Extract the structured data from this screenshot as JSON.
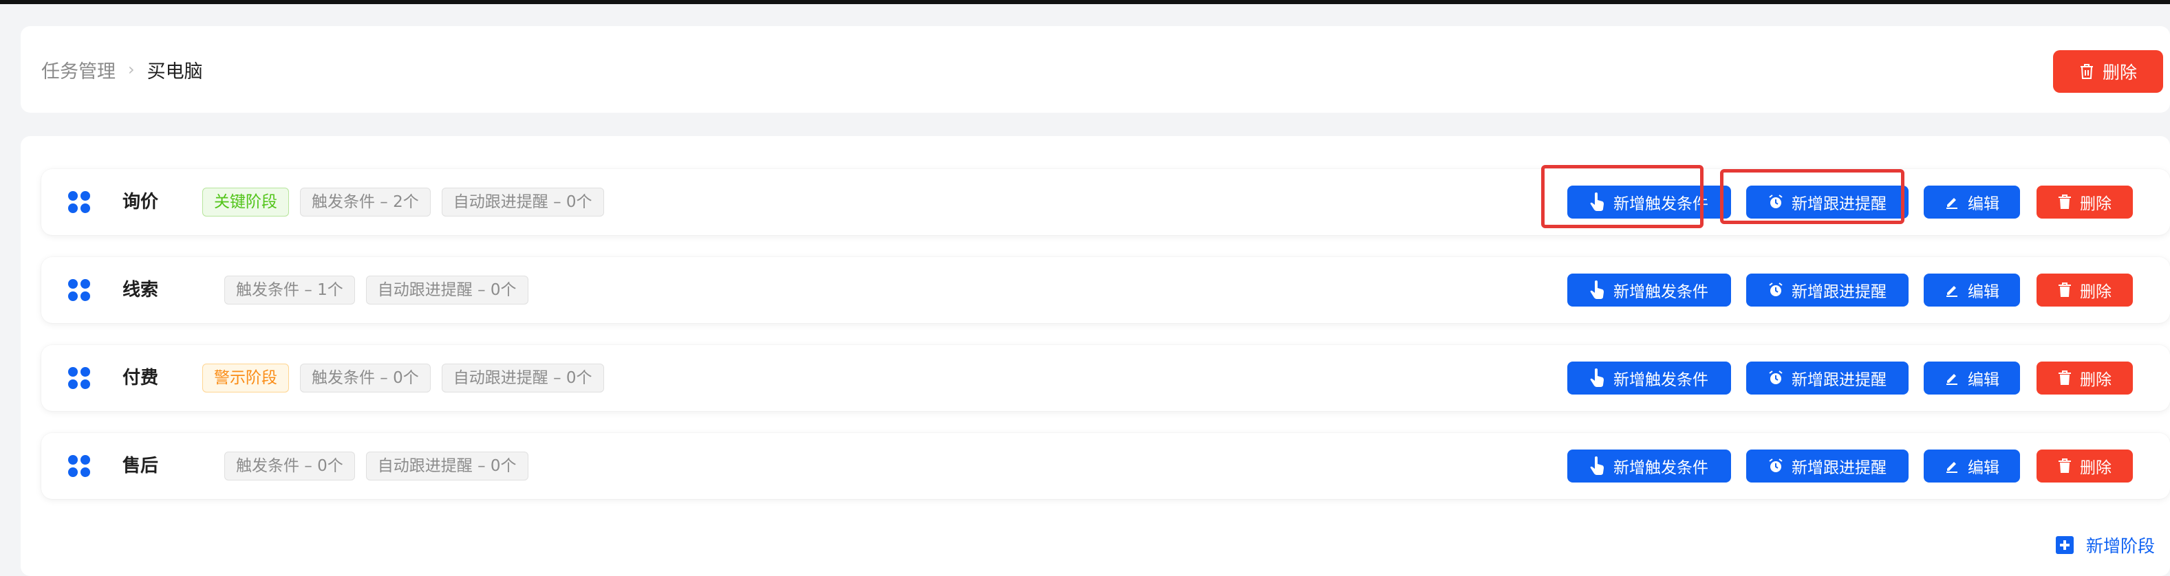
{
  "breadcrumb": {
    "root": "任务管理",
    "separator": "›",
    "current": "买电脑"
  },
  "header": {
    "delete_label": "删除"
  },
  "actions": {
    "add_trigger": "新增触发条件",
    "add_reminder": "新增跟进提醒",
    "edit": "编辑",
    "delete": "删除"
  },
  "stages": [
    {
      "name": "询价",
      "badge": "关键阶段",
      "badge_type": "key",
      "trigger_tag": "触发条件 – 2个",
      "reminder_tag": "自动跟进提醒 – 0个"
    },
    {
      "name": "线索",
      "badge": "",
      "badge_type": "",
      "trigger_tag": "触发条件 – 1个",
      "reminder_tag": "自动跟进提醒 – 0个"
    },
    {
      "name": "付费",
      "badge": "警示阶段",
      "badge_type": "warn",
      "trigger_tag": "触发条件 – 0个",
      "reminder_tag": "自动跟进提醒 – 0个"
    },
    {
      "name": "售后",
      "badge": "",
      "badge_type": "",
      "trigger_tag": "触发条件 – 0个",
      "reminder_tag": "自动跟进提醒 – 0个"
    }
  ],
  "add_stage_label": "新增阶段",
  "colors": {
    "primary": "#1062f2",
    "danger": "#f53f2a",
    "key_badge": "#52c41a",
    "warn_badge": "#fa8c16",
    "highlight": "#e53935"
  }
}
